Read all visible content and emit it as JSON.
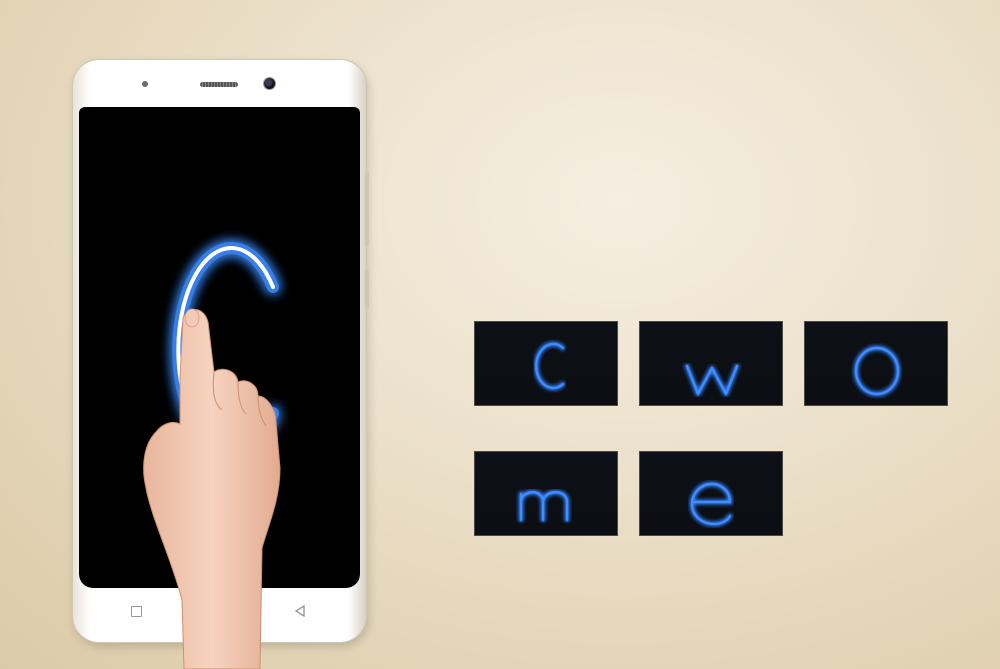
{
  "phone": {
    "screen_letter": "C",
    "nav_icons": [
      "square-home-icon",
      "triangle-back-icon"
    ]
  },
  "gesture_tiles": [
    {
      "letter": "c"
    },
    {
      "letter": "w"
    },
    {
      "letter": "o"
    },
    {
      "letter": "m"
    },
    {
      "letter": "e"
    }
  ],
  "colors": {
    "glow": "#3d8cff",
    "tile_bg": "#0c0f14",
    "background": "#ece1cb"
  }
}
